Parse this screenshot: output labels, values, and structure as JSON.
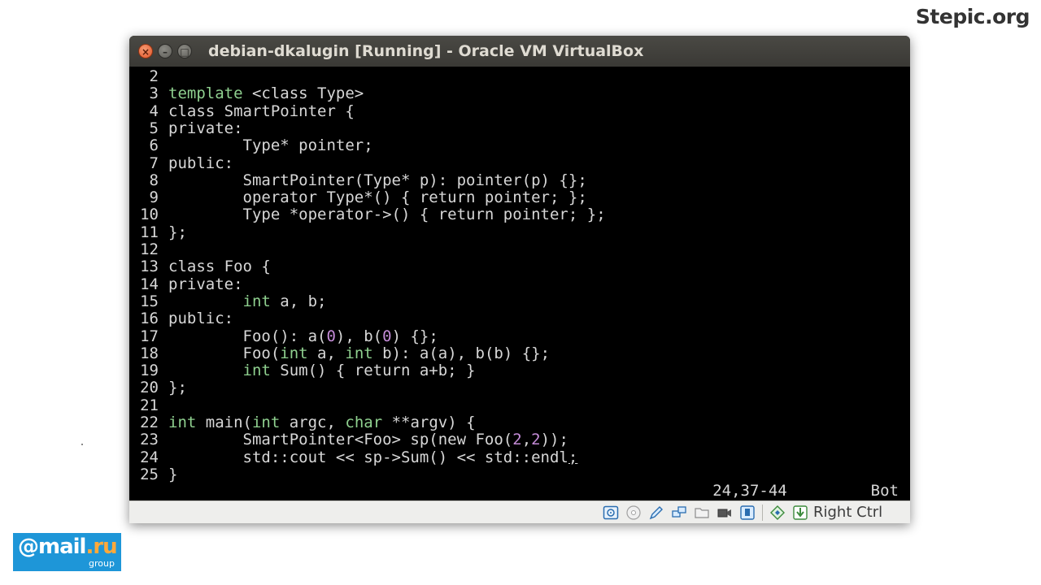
{
  "brand": "Stepic.org",
  "window": {
    "title": "debian-dkalugin [Running] - Oracle VM VirtualBox",
    "close_glyph": "×",
    "minimize_glyph": "–",
    "maximize_glyph": "□"
  },
  "editor": {
    "lines": [
      {
        "n": "2",
        "segs": []
      },
      {
        "n": "3",
        "segs": [
          {
            "t": "template",
            "c": "kw"
          },
          {
            "t": " <class Type>"
          }
        ]
      },
      {
        "n": "4",
        "segs": [
          {
            "t": "class SmartPointer {"
          }
        ]
      },
      {
        "n": "5",
        "segs": [
          {
            "t": "private:"
          }
        ]
      },
      {
        "n": "6",
        "segs": [
          {
            "t": "        Type* pointer;"
          }
        ]
      },
      {
        "n": "7",
        "segs": [
          {
            "t": "public:"
          }
        ]
      },
      {
        "n": "8",
        "segs": [
          {
            "t": "        SmartPointer(Type* p): pointer(p) {};"
          }
        ]
      },
      {
        "n": "9",
        "segs": [
          {
            "t": "        operator Type*() { return pointer; };"
          }
        ]
      },
      {
        "n": "10",
        "segs": [
          {
            "t": "        Type *operator->() { return pointer; };"
          }
        ]
      },
      {
        "n": "11",
        "segs": [
          {
            "t": "};"
          }
        ]
      },
      {
        "n": "12",
        "segs": []
      },
      {
        "n": "13",
        "segs": [
          {
            "t": "class Foo {"
          }
        ]
      },
      {
        "n": "14",
        "segs": [
          {
            "t": "private:"
          }
        ]
      },
      {
        "n": "15",
        "segs": [
          {
            "t": "        "
          },
          {
            "t": "int",
            "c": "kw"
          },
          {
            "t": " a, b;"
          }
        ]
      },
      {
        "n": "16",
        "segs": [
          {
            "t": "public:"
          }
        ]
      },
      {
        "n": "17",
        "segs": [
          {
            "t": "        Foo(): a("
          },
          {
            "t": "0",
            "c": "num"
          },
          {
            "t": "), b("
          },
          {
            "t": "0",
            "c": "num"
          },
          {
            "t": ") {};"
          }
        ]
      },
      {
        "n": "18",
        "segs": [
          {
            "t": "        Foo("
          },
          {
            "t": "int",
            "c": "kw"
          },
          {
            "t": " a, "
          },
          {
            "t": "int",
            "c": "kw"
          },
          {
            "t": " b): a(a), b(b) {};"
          }
        ]
      },
      {
        "n": "19",
        "segs": [
          {
            "t": "        "
          },
          {
            "t": "int",
            "c": "kw"
          },
          {
            "t": " Sum() { return a+b; }"
          }
        ]
      },
      {
        "n": "20",
        "segs": [
          {
            "t": "};"
          }
        ]
      },
      {
        "n": "21",
        "segs": []
      },
      {
        "n": "22",
        "segs": [
          {
            "t": "int",
            "c": "kw"
          },
          {
            "t": " main("
          },
          {
            "t": "int",
            "c": "kw"
          },
          {
            "t": " argc, "
          },
          {
            "t": "char",
            "c": "kw"
          },
          {
            "t": " **argv) {"
          }
        ]
      },
      {
        "n": "23",
        "segs": [
          {
            "t": "        SmartPointer<Foo> sp(new Foo("
          },
          {
            "t": "2",
            "c": "num"
          },
          {
            "t": ","
          },
          {
            "t": "2",
            "c": "num"
          },
          {
            "t": "));"
          }
        ]
      },
      {
        "n": "24",
        "segs": [
          {
            "t": "        std::cout << sp->Sum() << std::endl"
          },
          {
            "t": ";",
            "c": "cur"
          }
        ]
      },
      {
        "n": "25",
        "segs": [
          {
            "t": "}"
          }
        ]
      }
    ],
    "cursor_position": "24,37-44",
    "scroll_position": "Bot"
  },
  "statusbar": {
    "icons": [
      "hard-disk-icon",
      "optical-drive-icon",
      "pencil-icon",
      "network-icon",
      "shared-folders-icon",
      "video-capture-icon",
      "usb-icon",
      "mouse-integration-icon",
      "host-key-arrow-icon"
    ],
    "host_key": "Right Ctrl"
  },
  "mailru": {
    "logo": "@mail.ru",
    "sub": "group"
  },
  "colors": {
    "keyword": "#8fd08f",
    "number": "#c58cd8",
    "text": "#d7d7d7",
    "terminal_bg": "#000000",
    "mailru_bg": "#1e96d8"
  }
}
